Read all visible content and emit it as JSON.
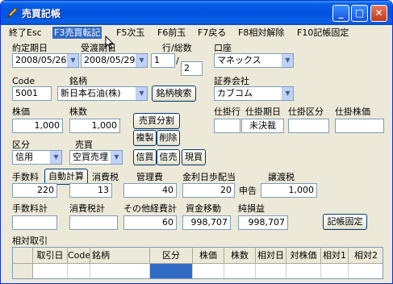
{
  "window": {
    "title": "売買記帳",
    "minimize": "_",
    "maximize": "□",
    "close": "✕"
  },
  "menu": [
    "終了Esc",
    "F3売買転記",
    "F5次玉",
    "F6前玉",
    "F7戻る",
    "F8相対解除",
    "F10記帳固定"
  ],
  "labels": {
    "contract_date": "約定期日",
    "delivery_date": "受渡期日",
    "rows_total": "行/総数",
    "account": "口座",
    "code": "Code",
    "brand": "銘柄",
    "securities_co": "証券会社",
    "unit_price": "株価",
    "shares": "株数",
    "pending_row": "仕掛行",
    "pending_date": "仕掛期日",
    "pending_class": "仕掛区分",
    "pending_price": "仕掛株価",
    "category": "区分",
    "trade": "売買",
    "fee": "手数料",
    "consumption_tax": "消費税",
    "mgmt_fee": "管理費",
    "interest": "金利日歩配当",
    "transfer_tax": "譲渡税",
    "fee_total": "手数料計",
    "tax_total": "消費税計",
    "other_total": "その他経費計",
    "fund_move": "資金移動",
    "net_pl": "純損益",
    "relative_trades": "相対取引"
  },
  "values": {
    "contract_date": "2008/05/26",
    "delivery_date": "2008/05/29",
    "row": "1",
    "total": "2",
    "account": "マネックス",
    "code": "5001",
    "brand": "新日本石油(株)",
    "securities_co": "カブコム",
    "unit_price": "1,000",
    "shares": "1,000",
    "pending_row": "",
    "pending_date": "未決裁",
    "pending_class": "",
    "pending_price": "",
    "category": "信用",
    "trade": "空買売埋",
    "fee": "220",
    "consumption_tax": "13",
    "mgmt_fee": "40",
    "interest": "20",
    "declare": "申告",
    "transfer_tax": "1,000",
    "fee_total": "",
    "tax_total": "",
    "other_total": "60",
    "fund_move": "998,707",
    "net_pl": "998,707"
  },
  "buttons": {
    "brand_search": "銘柄検索",
    "auto_calc": "自動計算",
    "split": "売買分割",
    "copy": "複製",
    "delete": "削除",
    "margin_buy": "信買",
    "margin_sell": "信売",
    "cash_buy": "現買",
    "fix_entry": "記帳固定"
  },
  "grid": {
    "columns": [
      "",
      "取引日",
      "Code",
      "銘柄",
      "区分",
      "株価",
      "株数",
      "相対日",
      "対株価",
      "相対1",
      "相対2"
    ]
  }
}
